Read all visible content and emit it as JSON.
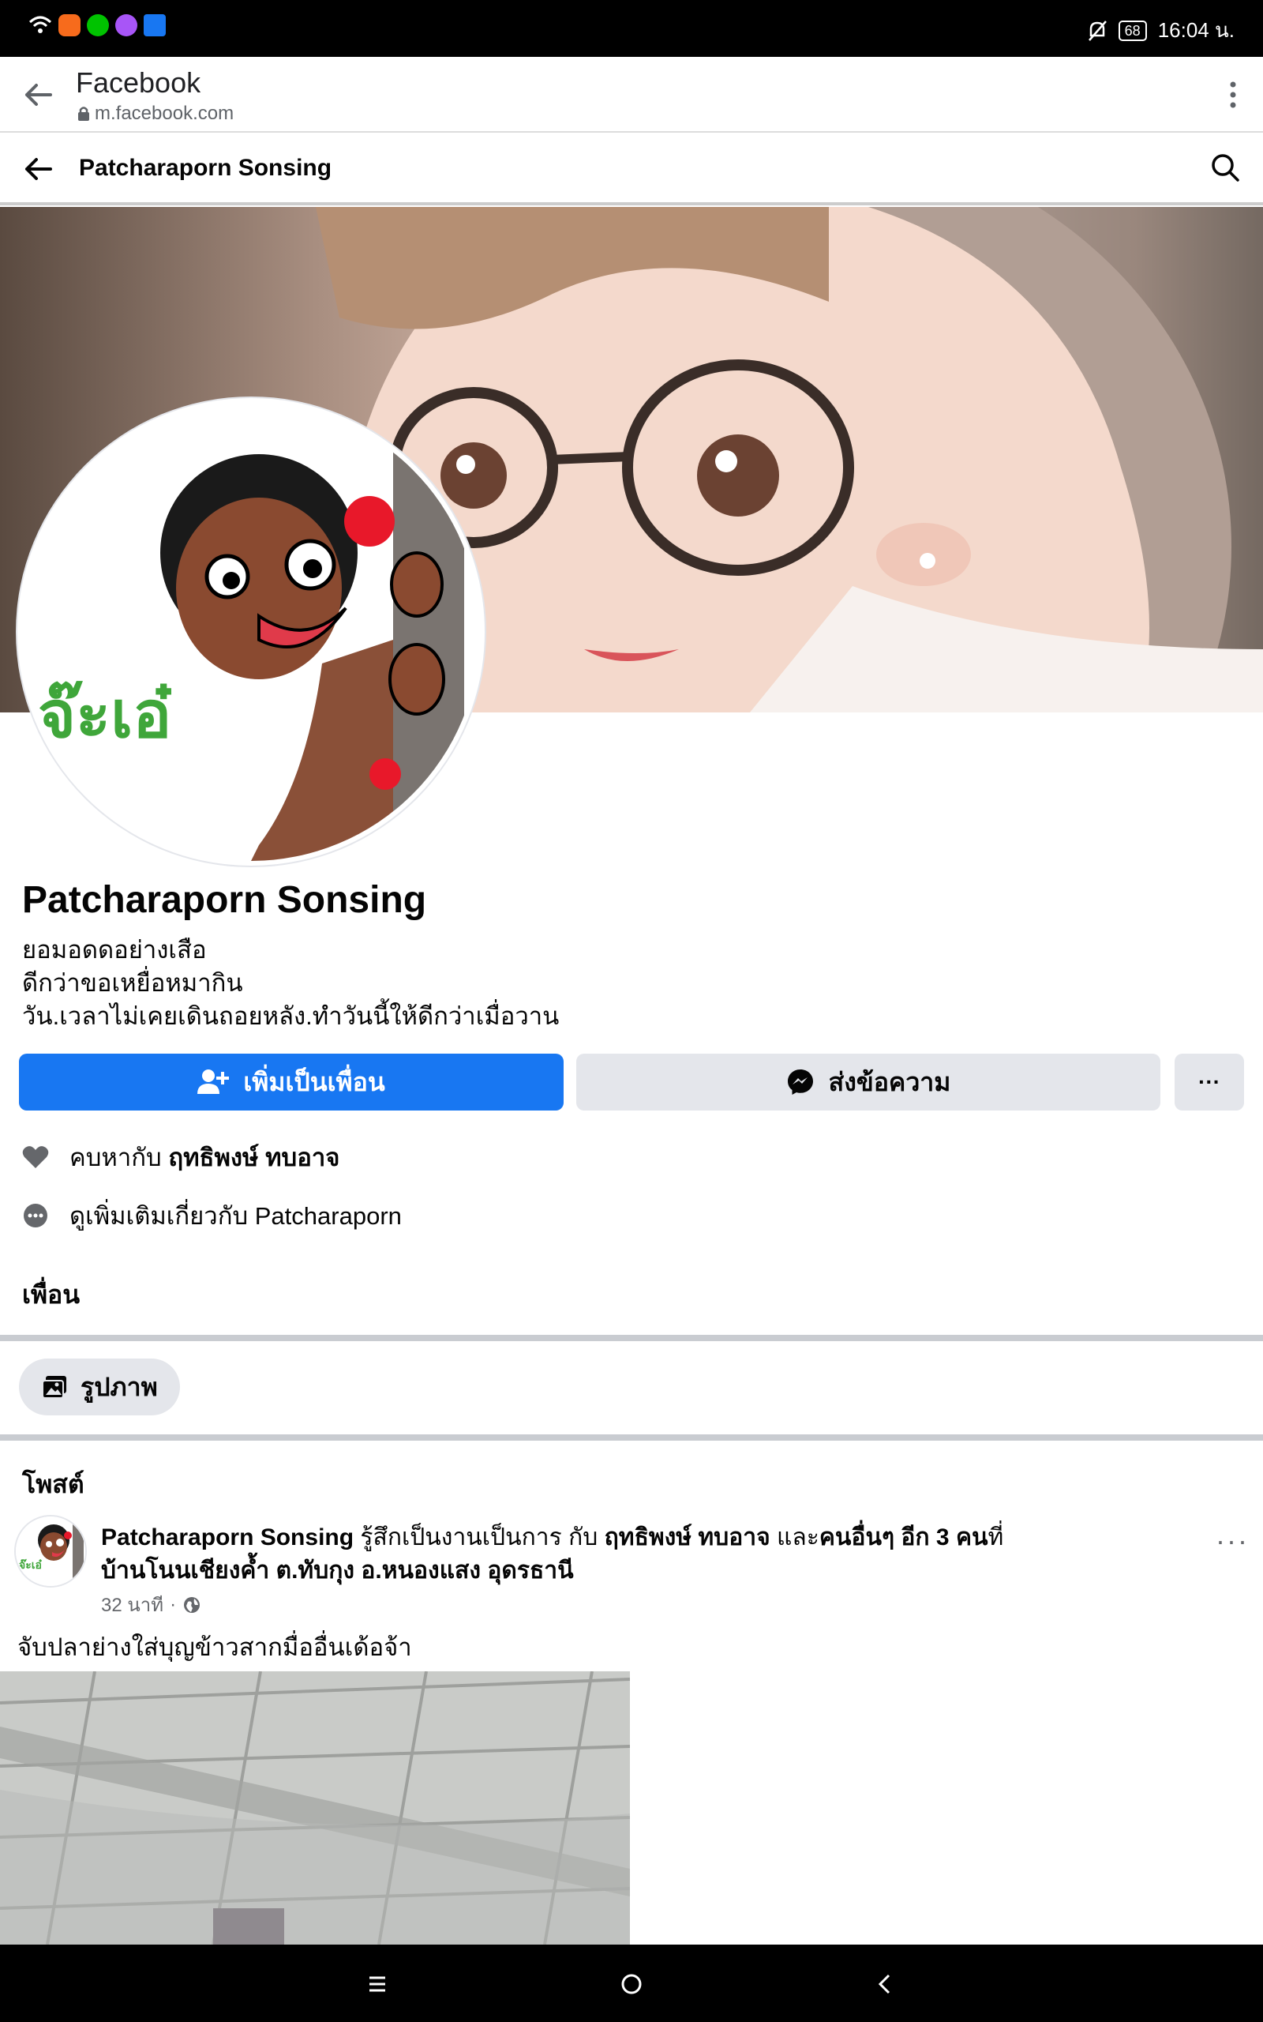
{
  "status_bar": {
    "battery": "68",
    "time": "16:04 น.",
    "app_icon_colors": [
      "#f76b1c",
      "#00c300",
      "#a855f7",
      "#1877f2"
    ]
  },
  "browser": {
    "title": "Facebook",
    "url": "m.facebook.com"
  },
  "header": {
    "name": "Patcharaporn Sonsing"
  },
  "avatar": {
    "sticker_text": "จ๊ะเอ๋"
  },
  "profile": {
    "name": "Patcharaporn Sonsing",
    "bio_lines": [
      "ยอมอดดอย่างเสือ",
      "ดีกว่าขอเหยื่อหมากิน",
      "วัน.เวลาไม่เคยเดินถอยหลัง.ทำวันนี้ให้ดีกว่าเมื่อวาน"
    ]
  },
  "actions": {
    "add_friend": "เพิ่มเป็นเพื่อน",
    "message": "ส่งข้อความ",
    "more": "···"
  },
  "details": {
    "relationship_prefix": "คบหากับ",
    "relationship_name": "ฤทธิพงษ์ ทบอาจ",
    "see_more": "ดูเพิ่มเติมเกี่ยวกับ Patcharaporn"
  },
  "sections": {
    "friends": "เพื่อน",
    "photos": "รูปภาพ",
    "posts": "โพสต์"
  },
  "post": {
    "author": "Patcharaporn Sonsing",
    "feeling": "รู้สึกเป็นงานเป็นการ กับ",
    "tagged": "ฤทธิพงษ์ ทบอาจ",
    "and": "และ",
    "others": "คนอื่นๆ อีก 3 คน",
    "at": "ที่",
    "location": "บ้านโนนเชียงค้ำ ต.ทับกุง อ.หนองแสง อุดรธานี",
    "time": "32 นาที",
    "dot": "·",
    "text": "จับปลาย่างใส่บุญข้าวสากมื่ออื่นเด้อจ้า",
    "more": "···"
  },
  "colors": {
    "primary": "#1877f2",
    "button_gray": "#e4e6eb",
    "text": "#050505",
    "secondary_text": "#65676b"
  }
}
